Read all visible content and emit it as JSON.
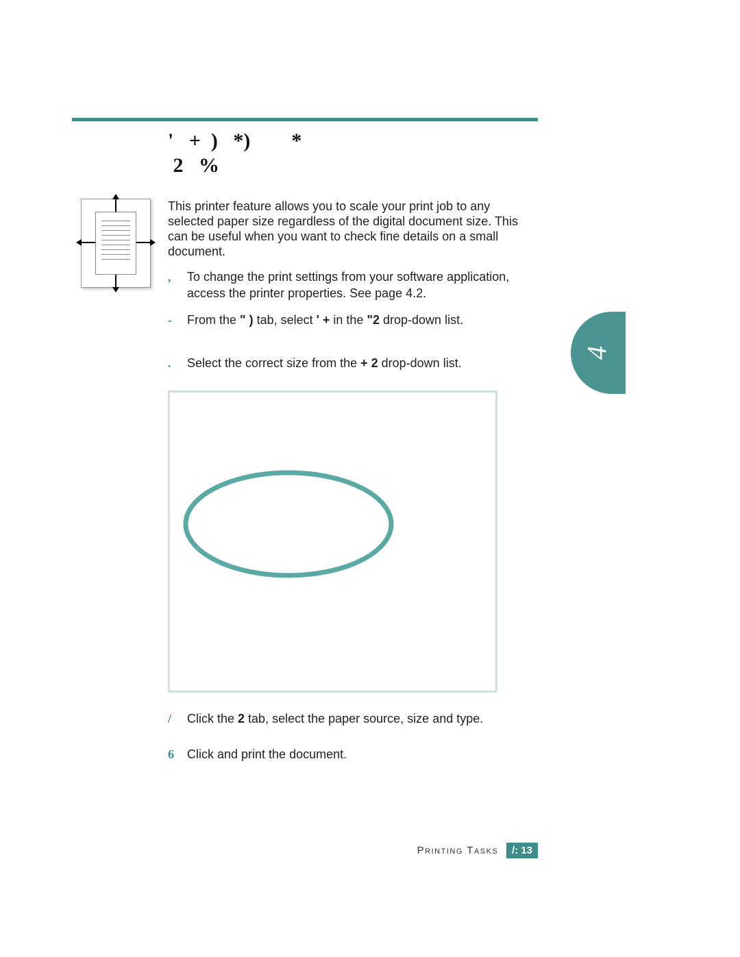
{
  "accent_color": "#3e8d8a",
  "heading": {
    "line1": "'   +  )   *)        *",
    "line2": " 2   %"
  },
  "intro": "This printer feature allows you to scale your print job to any selected paper size regardless of the digital document size. This can be useful when you want to check fine details on a small document.",
  "steps": [
    {
      "num": ",",
      "parts": [
        "To change the print settings from your software application, access the printer properties. See page 4.2."
      ]
    },
    {
      "num": "-",
      "parts": [
        "From the ",
        "\" )",
        " tab, select ",
        "'     +",
        " in the ",
        "\"2",
        " drop-down list."
      ]
    },
    {
      "num": ".",
      "parts": [
        "Select the correct size from the ",
        "  +   2",
        " drop-down list."
      ]
    },
    {
      "num": "/",
      "parts": [
        "Click the ",
        " 2",
        " tab, select the paper source, size and type."
      ]
    },
    {
      "num": "6",
      "parts": [
        "Click ",
        "   ",
        " and print the document."
      ]
    }
  ],
  "side_tab": "4",
  "footer": {
    "label": "Printing Tasks",
    "page": "/: 13"
  }
}
